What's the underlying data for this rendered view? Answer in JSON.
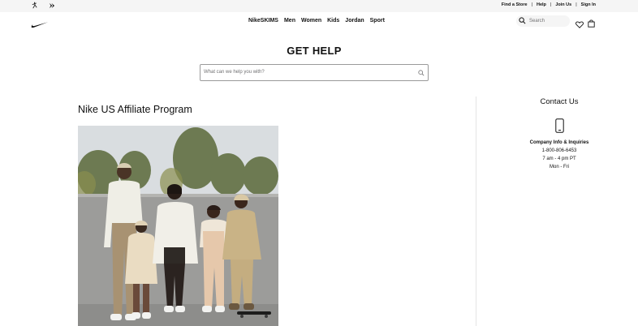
{
  "utility_bar": {
    "links": [
      "Find a Store",
      "Help",
      "Join Us",
      "Sign In"
    ],
    "brand_icons": [
      "jordan-jumpman-icon",
      "converse-icon"
    ]
  },
  "nav": {
    "logo": "nike-swoosh-icon",
    "links": [
      "NikeSKIMS",
      "Men",
      "Women",
      "Kids",
      "Jordan",
      "Sport"
    ],
    "search_placeholder": "Search",
    "icons": [
      "search-icon",
      "heart-icon",
      "bag-icon"
    ]
  },
  "help": {
    "title": "GET HELP",
    "search_placeholder": "What can we help you with?"
  },
  "article": {
    "title": "Nike US Affiliate Program"
  },
  "contact": {
    "title": "Contact Us",
    "icon": "phone-icon",
    "subtitle": "Company Info & Inquiries",
    "phone": "1-800-806-6453",
    "hours": "7 am - 4 pm PT",
    "days": "Mon - Fri"
  },
  "colors": {
    "utility_bg": "#f5f5f5",
    "text": "#111111",
    "muted": "#707072",
    "divider": "#e5e5e5"
  }
}
